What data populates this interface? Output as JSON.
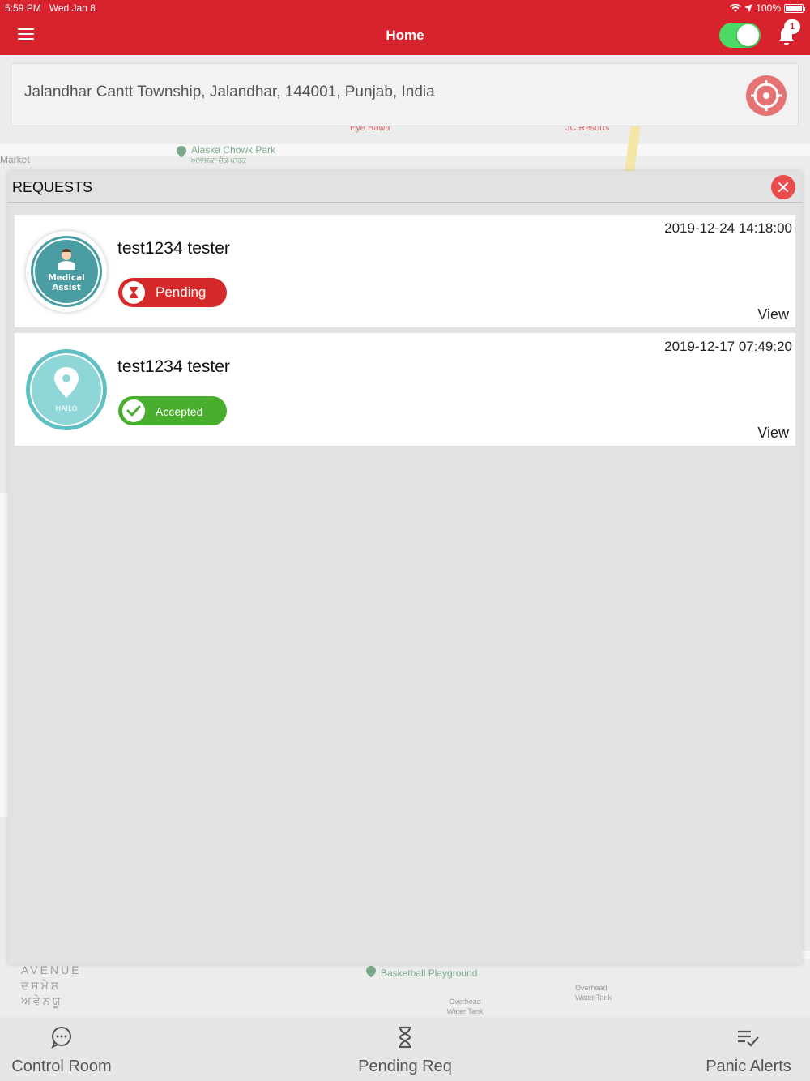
{
  "status_bar": {
    "time": "5:59 PM",
    "date": "Wed Jan 8",
    "battery": "100%"
  },
  "header": {
    "title": "Home",
    "notification_count": "1",
    "toggle_on": true
  },
  "address": {
    "value": "Jalandhar Cantt Township, Jalandhar, 144001, Punjab, India"
  },
  "map_labels": {
    "alaska": "Alaska Chowk Park",
    "alaska_punjabi": "ਅਲਾਸਕਾ ਚੌਕ ਪਾਰਕ",
    "market": "Market",
    "eye_bawa": "Eye Bawa",
    "jc_resorts": "JC Resorts",
    "basketball": "Basketball Playground",
    "overhead1": "Overhead Water Tank",
    "overhead2": "Overhead Water Tank",
    "avenue_line1": "AVENUE",
    "avenue_line2": "ਦਸਮੇਸ਼",
    "avenue_line3": "ਅਵੇਨਯੂ"
  },
  "requests": {
    "title": "REQUESTS",
    "items": [
      {
        "name": "test1234 tester",
        "date": "2019-12-24 14:18:00",
        "status": "Pending",
        "view": "View",
        "badge_line1": "Medical",
        "badge_line2": "Assist"
      },
      {
        "name": "test1234 tester",
        "date": "2019-12-17 07:49:20",
        "status": "Accepted",
        "view": "View",
        "badge_line1": "HAILO"
      }
    ]
  },
  "tabs": [
    {
      "label": "Control Room",
      "icon": "chat-icon"
    },
    {
      "label": "Pending Req",
      "icon": "hourglass-icon"
    },
    {
      "label": "Panic Alerts",
      "icon": "checklist-icon"
    }
  ],
  "colors": {
    "brand": "#d8232f",
    "pending": "#d62a2a",
    "accepted": "#49ad2d",
    "toggle": "#4cd964"
  }
}
